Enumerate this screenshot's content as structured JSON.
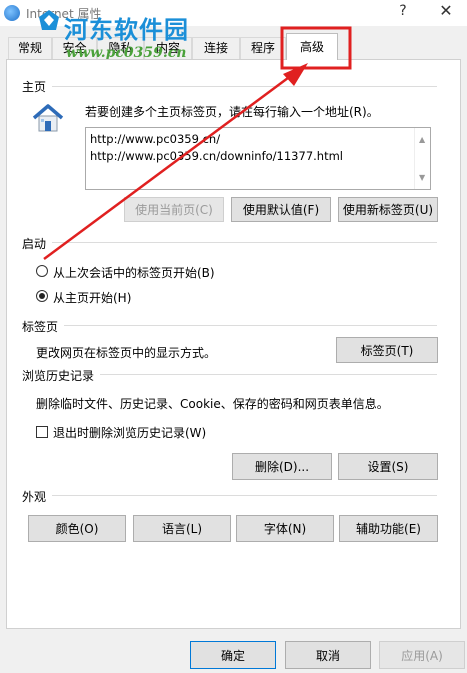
{
  "window": {
    "title": "Internet 属性",
    "help_label": "?",
    "close_label": "✕"
  },
  "watermark": {
    "site_name": "河东软件园",
    "url": "www.pc0359.cn"
  },
  "tabs": [
    {
      "label": "常规",
      "selected": false
    },
    {
      "label": "安全",
      "selected": false
    },
    {
      "label": "隐私",
      "selected": false
    },
    {
      "label": "内容",
      "selected": false
    },
    {
      "label": "连接",
      "selected": false
    },
    {
      "label": "程序",
      "selected": false
    },
    {
      "label": "高级",
      "selected": true
    }
  ],
  "home": {
    "heading": "主页",
    "instruction": "若要创建多个主页标签页，请在每行输入一个地址(R)。",
    "url_line_1": "http://www.pc0359.cn/",
    "url_line_2": "http://www.pc0359.cn/downinfo/11377.html",
    "use_current_label": "使用当前页(C)",
    "use_default_label": "使用默认值(F)",
    "use_new_tab_label": "使用新标签页(U)"
  },
  "startup": {
    "heading": "启动",
    "option_last_session": "从上次会话中的标签页开始(B)",
    "option_home": "从主页开始(H)",
    "selected": "home"
  },
  "tabs_section": {
    "heading": "标签页",
    "description": "更改网页在标签页中的显示方式。",
    "button_label": "标签页(T)"
  },
  "history": {
    "heading": "浏览历史记录",
    "description": "删除临时文件、历史记录、Cookie、保存的密码和网页表单信息。",
    "delete_on_exit_label": "退出时删除浏览历史记录(W)",
    "delete_on_exit_checked": false,
    "delete_label": "删除(D)...",
    "settings_label": "设置(S)"
  },
  "appearance": {
    "heading": "外观",
    "colors_label": "颜色(O)",
    "languages_label": "语言(L)",
    "fonts_label": "字体(N)",
    "accessibility_label": "辅助功能(E)"
  },
  "footer": {
    "ok_label": "确定",
    "cancel_label": "取消",
    "apply_label": "应用(A)"
  },
  "annotation": {
    "color": "#e02020"
  }
}
